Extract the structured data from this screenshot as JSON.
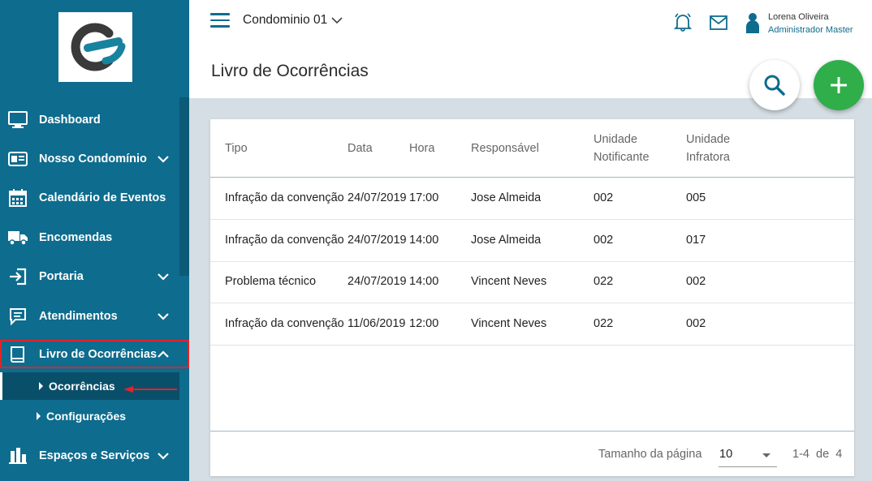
{
  "sidebar": {
    "items": [
      {
        "label": "Dashboard",
        "icon": "monitor-icon"
      },
      {
        "label": "Nosso Condomínio",
        "icon": "id-card-icon"
      },
      {
        "label": "Calendário de Eventos",
        "icon": "calendar-icon"
      },
      {
        "label": "Encomendas",
        "icon": "truck-icon"
      },
      {
        "label": "Portaria",
        "icon": "login-icon"
      },
      {
        "label": "Atendimentos",
        "icon": "chat-icon"
      },
      {
        "label": "Livro de Ocorrências",
        "icon": "book-icon"
      },
      {
        "label": "Espaços e Serviços",
        "icon": "building-icon"
      }
    ],
    "subitems": [
      {
        "label": "Ocorrências"
      },
      {
        "label": "Configurações"
      }
    ]
  },
  "header": {
    "condo": "Condominio 01",
    "title": "Livro de Ocorrências",
    "user_name": "Lorena Oliveira",
    "user_role": "Administrador Master"
  },
  "table": {
    "columns": [
      "Tipo",
      "Data",
      "Hora",
      "Responsável",
      "Unidade",
      "Notificante",
      "Unidade",
      "Infratora"
    ],
    "rows": [
      {
        "tipo": "Infração da convenção",
        "data": "24/07/2019",
        "hora": "17:00",
        "responsavel": "Jose Almeida",
        "notificante": "002",
        "infratora": "005"
      },
      {
        "tipo": "Infração da convenção",
        "data": "24/07/2019",
        "hora": "14:00",
        "responsavel": "Jose Almeida",
        "notificante": "002",
        "infratora": "017"
      },
      {
        "tipo": "Problema técnico",
        "data": "24/07/2019",
        "hora": "14:00",
        "responsavel": "Vincent Neves",
        "notificante": "022",
        "infratora": "002"
      },
      {
        "tipo": "Infração da convenção",
        "data": "11/06/2019",
        "hora": "12:00",
        "responsavel": "Vincent Neves",
        "notificante": "022",
        "infratora": "002"
      }
    ]
  },
  "pagination": {
    "label": "Tamanho da página",
    "size": "10",
    "range": "1-4  de  4"
  },
  "colors": {
    "sidebar": "#0e6c8e",
    "accent_green": "#2fae4a",
    "highlight_red": "#e0242a"
  }
}
